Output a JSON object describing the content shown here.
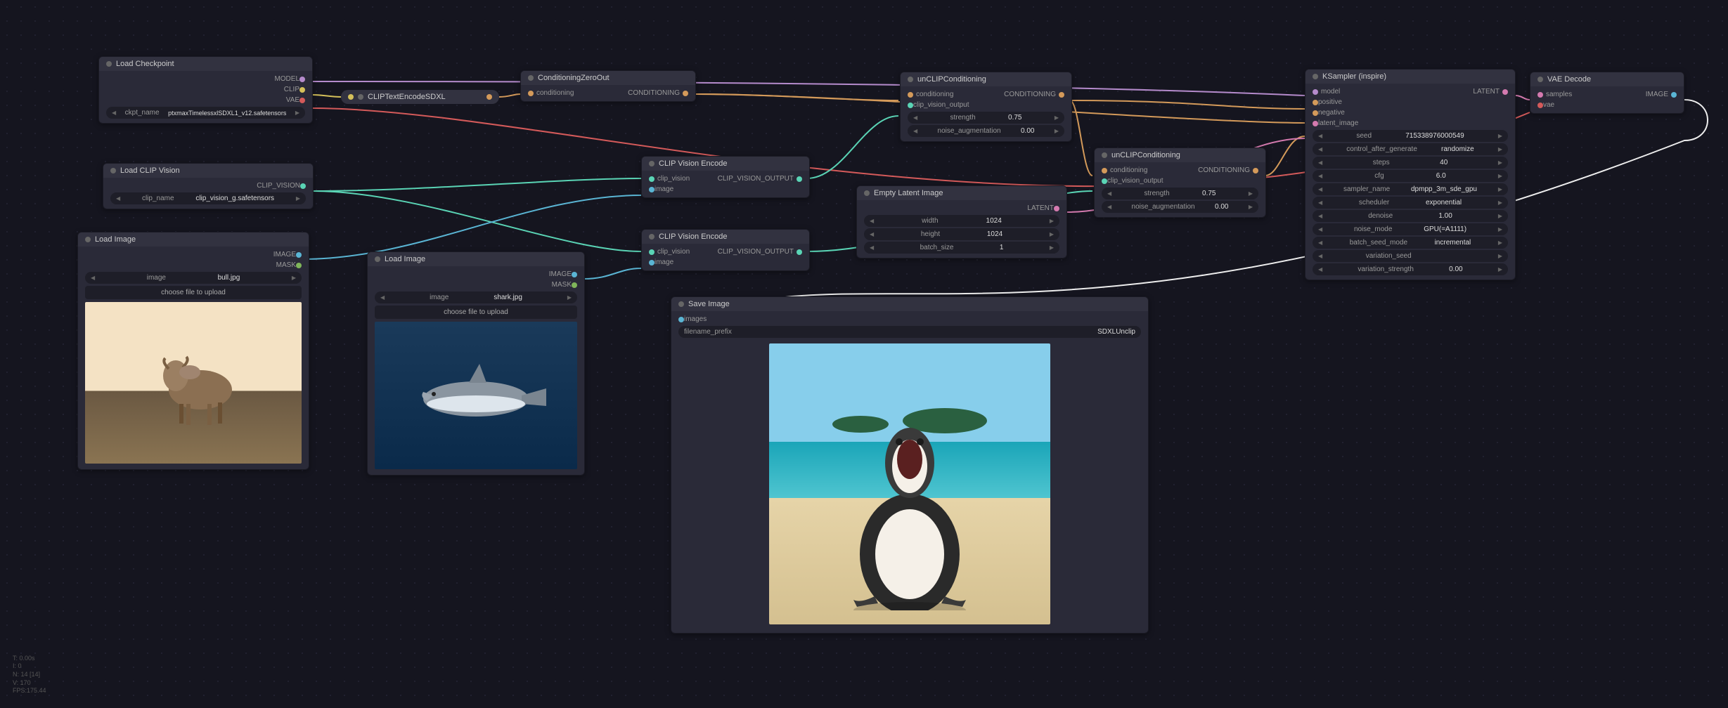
{
  "nodes": {
    "load_checkpoint": {
      "title": "Load Checkpoint",
      "outputs": [
        "MODEL",
        "CLIP",
        "VAE"
      ],
      "ckpt_label": "ckpt_name",
      "ckpt_value": "ptxmaxTimelessxlSDXL1_v12.safetensors"
    },
    "clip_text_encode": {
      "title": "CLIPTextEncodeSDXL"
    },
    "conditioning_zero": {
      "title": "ConditioningZeroOut",
      "input": "conditioning",
      "output": "CONDITIONING"
    },
    "load_clip_vision": {
      "title": "Load CLIP Vision",
      "output": "CLIP_VISION",
      "clip_name_label": "clip_name",
      "clip_name_value": "clip_vision_g.safetensors"
    },
    "load_image_1": {
      "title": "Load Image",
      "outputs": [
        "IMAGE",
        "MASK"
      ],
      "image_label": "image",
      "image_value": "bull.jpg",
      "upload": "choose file to upload"
    },
    "load_image_2": {
      "title": "Load Image",
      "outputs": [
        "IMAGE",
        "MASK"
      ],
      "image_label": "image",
      "image_value": "shark.jpg",
      "upload": "choose file to upload"
    },
    "clip_vision_encode_1": {
      "title": "CLIP Vision Encode",
      "inputs": [
        "clip_vision",
        "image"
      ],
      "output": "CLIP_VISION_OUTPUT"
    },
    "clip_vision_encode_2": {
      "title": "CLIP Vision Encode",
      "inputs": [
        "clip_vision",
        "image"
      ],
      "output": "CLIP_VISION_OUTPUT"
    },
    "unclip_1": {
      "title": "unCLIPConditioning",
      "inputs": [
        "conditioning",
        "clip_vision_output"
      ],
      "output": "CONDITIONING",
      "strength_label": "strength",
      "strength_value": "0.75",
      "noise_label": "noise_augmentation",
      "noise_value": "0.00"
    },
    "unclip_2": {
      "title": "unCLIPConditioning",
      "inputs": [
        "conditioning",
        "clip_vision_output"
      ],
      "output": "CONDITIONING",
      "strength_label": "strength",
      "strength_value": "0.75",
      "noise_label": "noise_augmentation",
      "noise_value": "0.00"
    },
    "empty_latent": {
      "title": "Empty Latent Image",
      "output": "LATENT",
      "width_label": "width",
      "width_value": "1024",
      "height_label": "height",
      "height_value": "1024",
      "batch_label": "batch_size",
      "batch_value": "1"
    },
    "ksampler": {
      "title": "KSampler (inspire)",
      "inputs": [
        "model",
        "positive",
        "negative",
        "latent_image"
      ],
      "output": "LATENT",
      "seed_label": "seed",
      "seed_value": "715338976000549",
      "control_label": "control_after_generate",
      "control_value": "randomize",
      "steps_label": "steps",
      "steps_value": "40",
      "cfg_label": "cfg",
      "cfg_value": "6.0",
      "sampler_label": "sampler_name",
      "sampler_value": "dpmpp_3m_sde_gpu",
      "scheduler_label": "scheduler",
      "scheduler_value": "exponential",
      "denoise_label": "denoise",
      "denoise_value": "1.00",
      "noise_mode_label": "noise_mode",
      "noise_mode_value": "GPU(=A1111)",
      "batch_seed_label": "batch_seed_mode",
      "batch_seed_value": "incremental",
      "var_seed_label": "variation_seed",
      "var_strength_label": "variation_strength",
      "var_strength_value": "0.00"
    },
    "vae_decode": {
      "title": "VAE Decode",
      "inputs": [
        "samples",
        "vae"
      ],
      "output": "IMAGE"
    },
    "save_image": {
      "title": "Save Image",
      "input": "images",
      "prefix_label": "filename_prefix",
      "prefix_value": "SDXLUnclip"
    }
  },
  "stats": {
    "t": "T: 0.00s",
    "i": "I: 0",
    "n": "N: 14 [14]",
    "v": "V: 170",
    "fps": "FPS:175.44"
  }
}
